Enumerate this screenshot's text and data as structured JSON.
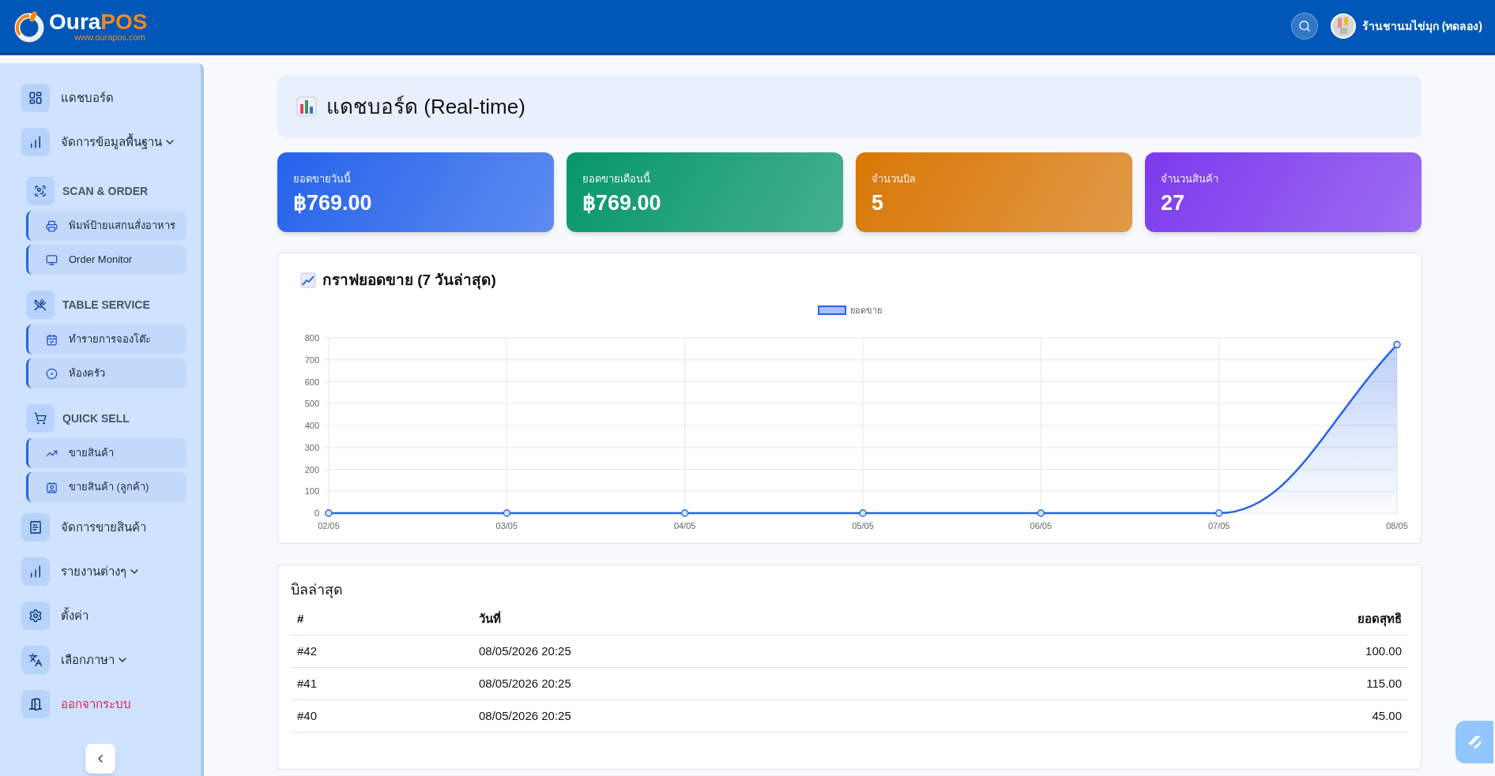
{
  "header": {
    "logo_text": "Oura",
    "logo_accent": "POS",
    "logo_url": "www.ourapos.com",
    "shop_name": "ร้านชานมไข่มุก (ทดลอง)"
  },
  "sidebar": {
    "items": [
      {
        "kind": "item",
        "label": "แดชบอร์ด",
        "has_dropdown": false,
        "danger": false
      },
      {
        "kind": "item",
        "label": "จัดการข้อมูลพื้นฐาน",
        "has_dropdown": true,
        "danger": false
      },
      {
        "kind": "section",
        "label": "SCAN & ORDER",
        "children": [
          {
            "label": "พิมพ์ป้ายแสกนสั่งอาหาร"
          },
          {
            "label": "Order Monitor"
          }
        ]
      },
      {
        "kind": "section",
        "label": "TABLE SERVICE",
        "children": [
          {
            "label": "ทำรายการจองโต๊ะ"
          },
          {
            "label": "ห้องครัว"
          }
        ]
      },
      {
        "kind": "section",
        "label": "QUICK SELL",
        "children": [
          {
            "label": "ขายสินค้า"
          },
          {
            "label": "ขายสินค้า (ลูกค้า)"
          }
        ]
      },
      {
        "kind": "item",
        "label": "จัดการขายสินค้า",
        "has_dropdown": false,
        "danger": false
      },
      {
        "kind": "item",
        "label": "รายงานต่างๆ",
        "has_dropdown": true,
        "danger": false
      },
      {
        "kind": "item",
        "label": "ตั้งค่า",
        "has_dropdown": false,
        "danger": false
      },
      {
        "kind": "item",
        "label": "เลือกภาษา",
        "has_dropdown": true,
        "danger": false
      },
      {
        "kind": "item",
        "label": "ออกจากระบบ",
        "has_dropdown": false,
        "danger": true
      }
    ]
  },
  "page_title": "แดชบอร์ด (Real-time)",
  "stats": [
    {
      "label": "ยอดขายวันนี้",
      "value": "฿769.00",
      "color": "#2563eb"
    },
    {
      "label": "ยอดขายเดือนนี้",
      "value": "฿769.00",
      "color": "#059669"
    },
    {
      "label": "จำนวนบิล",
      "value": "5",
      "color": "#d97706"
    },
    {
      "label": "จำนวนสินค้า",
      "value": "27",
      "color": "#7c3aed"
    }
  ],
  "sales_chart": {
    "title": "กราฟยอดขาย (7 วันล่าสุด)",
    "chart_data": {
      "type": "area",
      "categories": [
        "02/05",
        "03/05",
        "04/05",
        "05/05",
        "06/05",
        "07/05",
        "08/05"
      ],
      "series": [
        {
          "name": "ยอดขาย",
          "color": "#2563eb",
          "values": [
            0,
            0,
            0,
            0,
            0,
            0,
            769
          ]
        }
      ],
      "grid": true,
      "ylim": [
        0,
        800
      ],
      "yticks": [
        0,
        100,
        200,
        300,
        400,
        500,
        600,
        700,
        800
      ]
    }
  },
  "latest_bills": {
    "title": "บิลล่าสุด",
    "columns": [
      "#",
      "วันที่",
      "ยอดสุทธิ"
    ],
    "rows": [
      [
        "#42",
        "08/05/2026 20:25",
        "100.00"
      ],
      [
        "#41",
        "08/05/2026 20:25",
        "115.00"
      ],
      [
        "#40",
        "08/05/2026 20:25",
        "45.00"
      ]
    ]
  }
}
